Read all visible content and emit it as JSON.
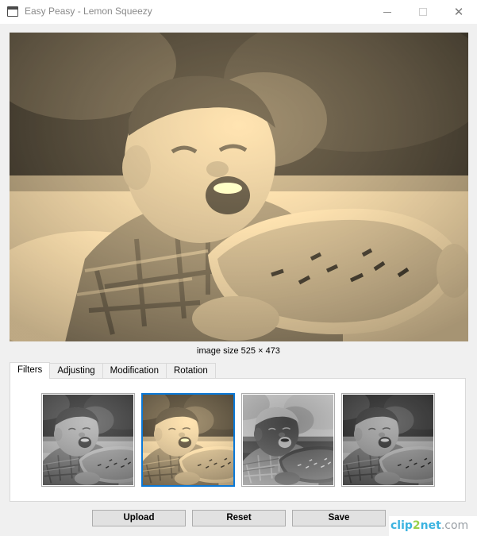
{
  "window": {
    "title": "Easy Peasy - Lemon Squeezy"
  },
  "titlebar_controls": [
    "minimize-icon",
    "maximize-icon",
    "close-icon"
  ],
  "image_info": {
    "size_label": "image size 525 × 473"
  },
  "tabs": [
    {
      "label": "Filters",
      "active": true
    },
    {
      "label": "Adjusting",
      "active": false
    },
    {
      "label": "Modification",
      "active": false
    },
    {
      "label": "Rotation",
      "active": false
    }
  ],
  "filters": [
    {
      "name": "grayscale",
      "selected": false
    },
    {
      "name": "sepia",
      "selected": true
    },
    {
      "name": "inverted",
      "selected": false
    },
    {
      "name": "grayscale-alt",
      "selected": false
    }
  ],
  "buttons": {
    "upload": "Upload",
    "reset": "Reset",
    "save": "Save"
  },
  "watermark": {
    "part1": "clip",
    "part2": "2",
    "part3": "net",
    "part4": ".com"
  },
  "colors": {
    "accent": "#0a78d7",
    "sepia_mid": "#8b7762",
    "button_bg": "#e1e1e1"
  }
}
